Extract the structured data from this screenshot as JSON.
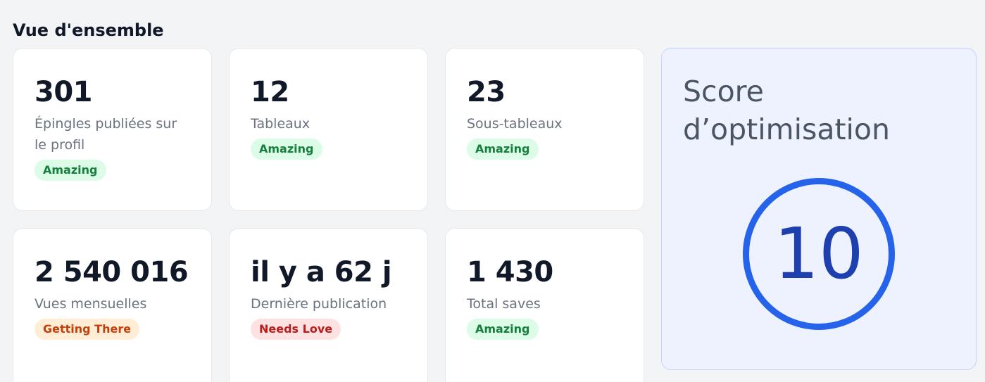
{
  "section_title": "Vue d'ensemble",
  "stats": [
    {
      "value": "301",
      "label": "Épingles publiées sur le profil",
      "badge": "Amazing"
    },
    {
      "value": "12",
      "label": "Tableaux",
      "badge": "Amazing"
    },
    {
      "value": "23",
      "label": "Sous-tableaux",
      "badge": "Amazing"
    },
    {
      "value": "2 540 016",
      "label": "Vues mensuelles",
      "badge": "Getting There"
    },
    {
      "value": "il y a 62 j",
      "label": "Dernière publication",
      "badge": "Needs Love"
    },
    {
      "value": "1 430",
      "label": "Total saves",
      "badge": "Amazing"
    }
  ],
  "score": {
    "title": "Score d’optimisation",
    "value": "10"
  },
  "colors": {
    "badge_good_bg": "#dcfce7",
    "badge_good_text": "#15803d",
    "badge_mid_bg": "#ffedd5",
    "badge_mid_text": "#c2410c",
    "badge_bad_bg": "#fee2e2",
    "badge_bad_text": "#b91c1c",
    "score_ring": "#2563eb"
  }
}
